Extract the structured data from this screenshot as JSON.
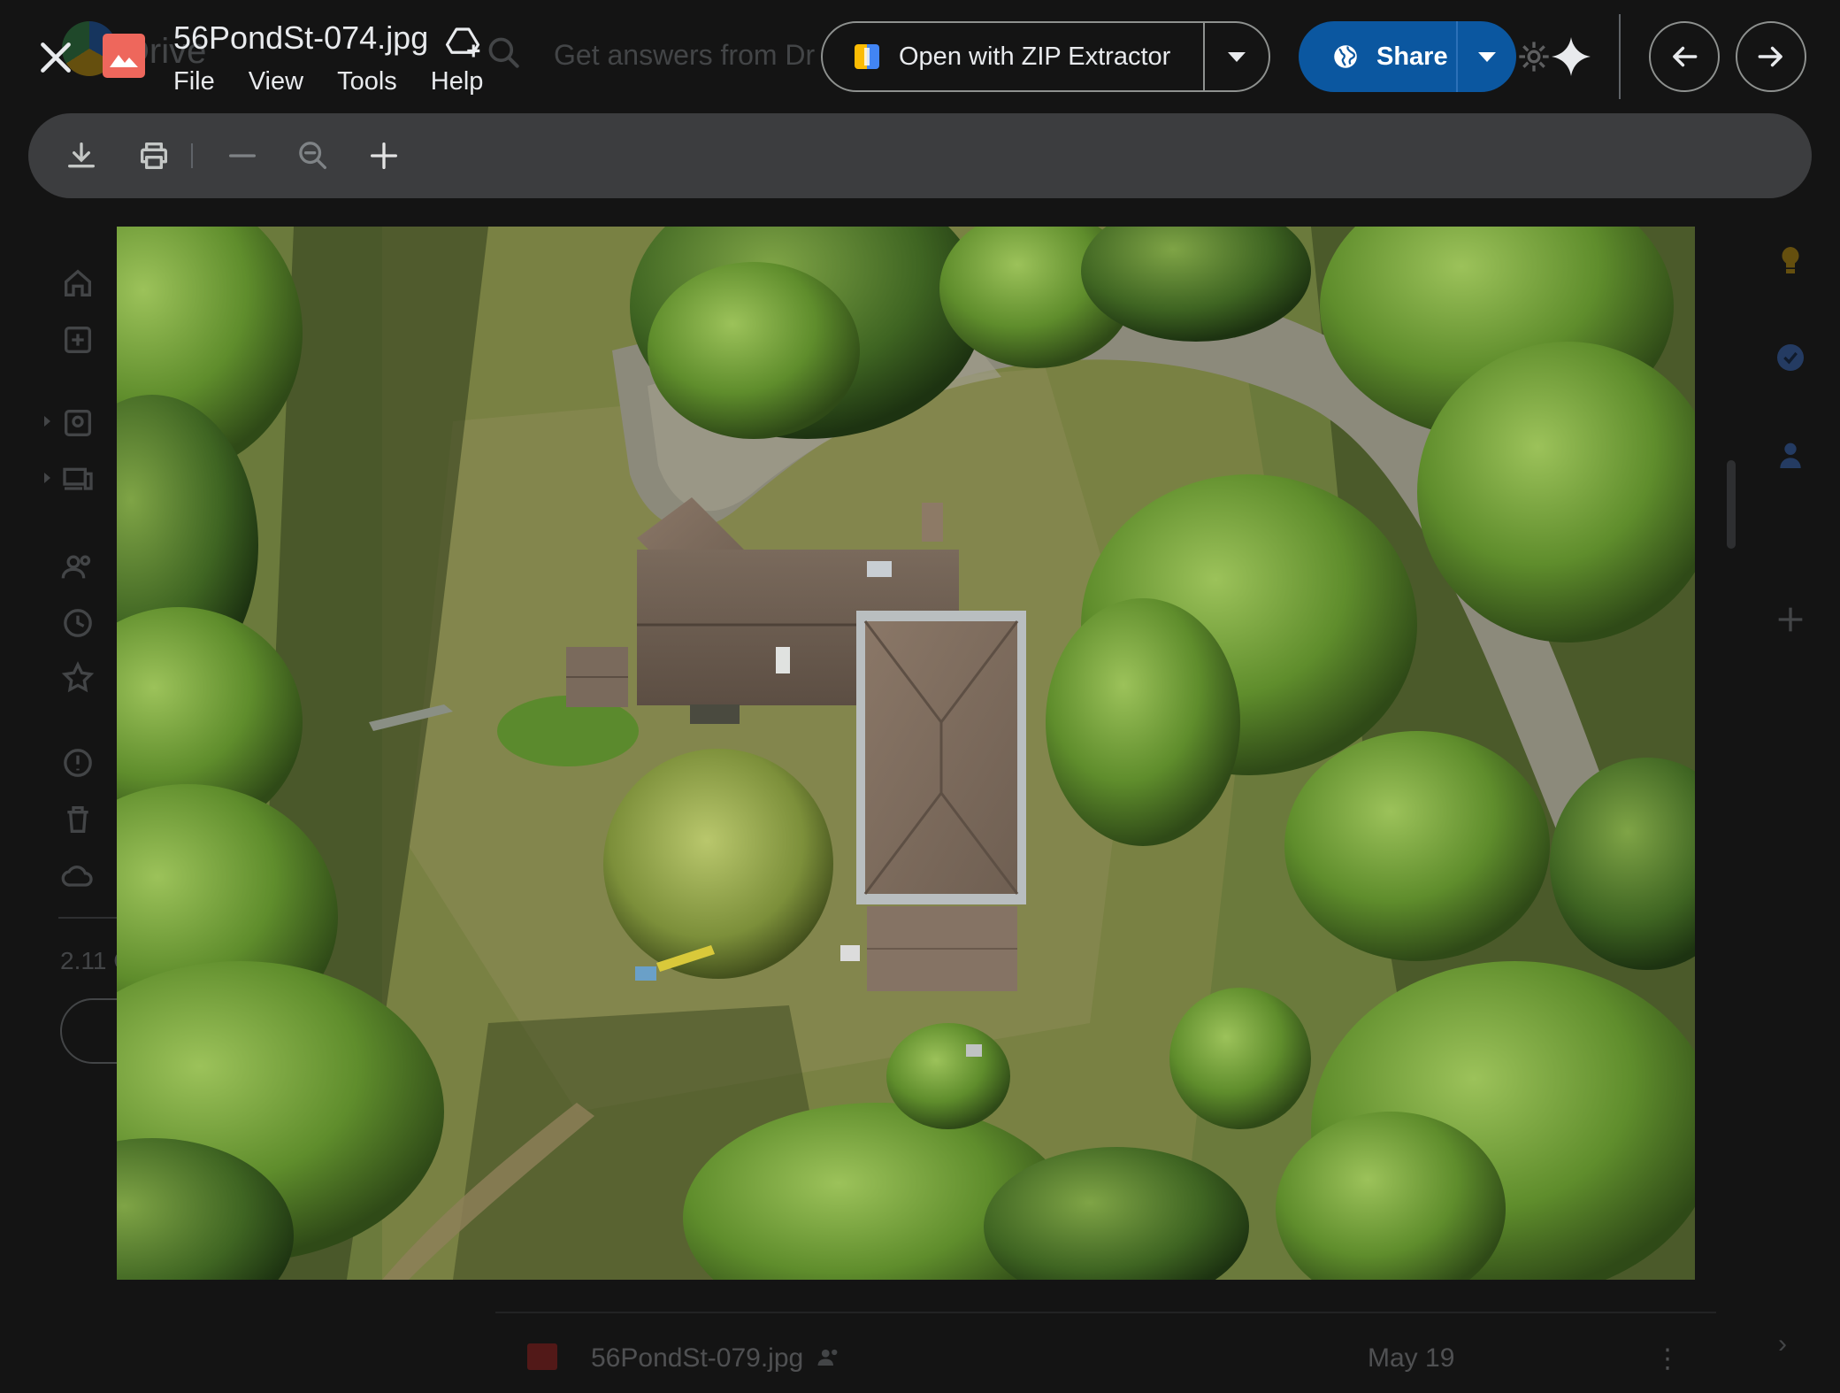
{
  "viewer": {
    "file_name": "56PondSt-074.jpg",
    "menu": [
      "File",
      "View",
      "Tools",
      "Help"
    ],
    "open_with_label": "Open with ZIP Extractor",
    "share_label": "Share",
    "icons": {
      "close": "close-icon",
      "file_type": "image-file-icon",
      "add_shortcut": "add-to-drive-icon",
      "gemini": "gemini-sparkle-icon",
      "prev": "arrow-left-icon",
      "next": "arrow-right-icon",
      "download": "download-icon",
      "print": "print-icon",
      "zoom_out": "minus-icon",
      "zoom_reset": "zoom-icon",
      "zoom_in": "plus-icon"
    },
    "colors": {
      "share_button": "#0b57a0",
      "toolbar": "#3c3d3f",
      "file_icon": "#ee675c"
    }
  },
  "background": {
    "app_name": "Drive",
    "search_placeholder": "Get answers from Dr",
    "storage_text": "2.11 G",
    "file_row": {
      "name": "56PondSt-079.jpg",
      "date": "May 19"
    }
  }
}
